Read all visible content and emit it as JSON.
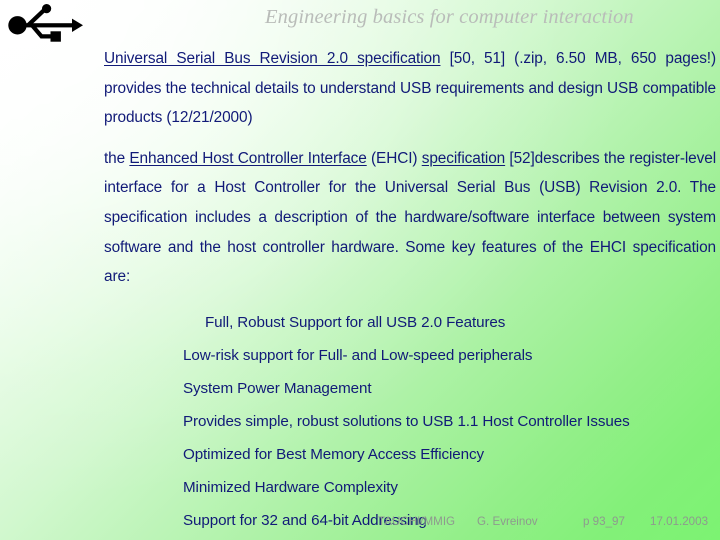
{
  "slide": {
    "title": "Engineering basics for computer interaction",
    "title_color": "#b9bcb9",
    "text_color": "#111a78",
    "background_from": "#ffffff",
    "background_to": "#7cf372"
  },
  "logo": {
    "name": "usb-logo",
    "color": "#000000"
  },
  "paragraphs": [
    {
      "id": "para-usb-spec",
      "runs": [
        {
          "text": "Universal Serial Bus Revision 2.0 specification",
          "underline": true
        },
        {
          "text": " [50, 51] (.zip, 6.50 MB, 650 pages!) provides the technical details to understand USB requirements and design USB compatible products (12/21/2000)",
          "underline": false
        }
      ]
    },
    {
      "id": "para-ehci",
      "runs": [
        {
          "text": "the ",
          "underline": false
        },
        {
          "text": "Enhanced Host Controller Interface",
          "underline": true
        },
        {
          "text": " (EHCI) ",
          "underline": false
        },
        {
          "text": "specification",
          "underline": true
        },
        {
          "text": " [52]describes the register-level interface for a Host Controller for the Universal Serial Bus (USB) Revision 2.0. The specification includes a description of the hardware/software interface between system software and the host controller hardware. Some key features of the EHCI specification are:",
          "underline": false
        }
      ]
    }
  ],
  "features": [
    "Full, Robust Support for all USB 2.0 Features",
    "Low-risk support for Full- and Low-speed peripherals",
    "System Power Management",
    "Provides simple, robust solutions to USB 1.1 Host Controller Issues",
    "Optimized for Best Memory Access Efficiency",
    "Minimized Hardware Complexity",
    "Support for 32 and 64-bit Addressing"
  ],
  "footer": {
    "org": "TAUCHI/MMIG",
    "author": "G. Evreinov",
    "pages": "p 93_97",
    "date": "17.01.2003"
  }
}
